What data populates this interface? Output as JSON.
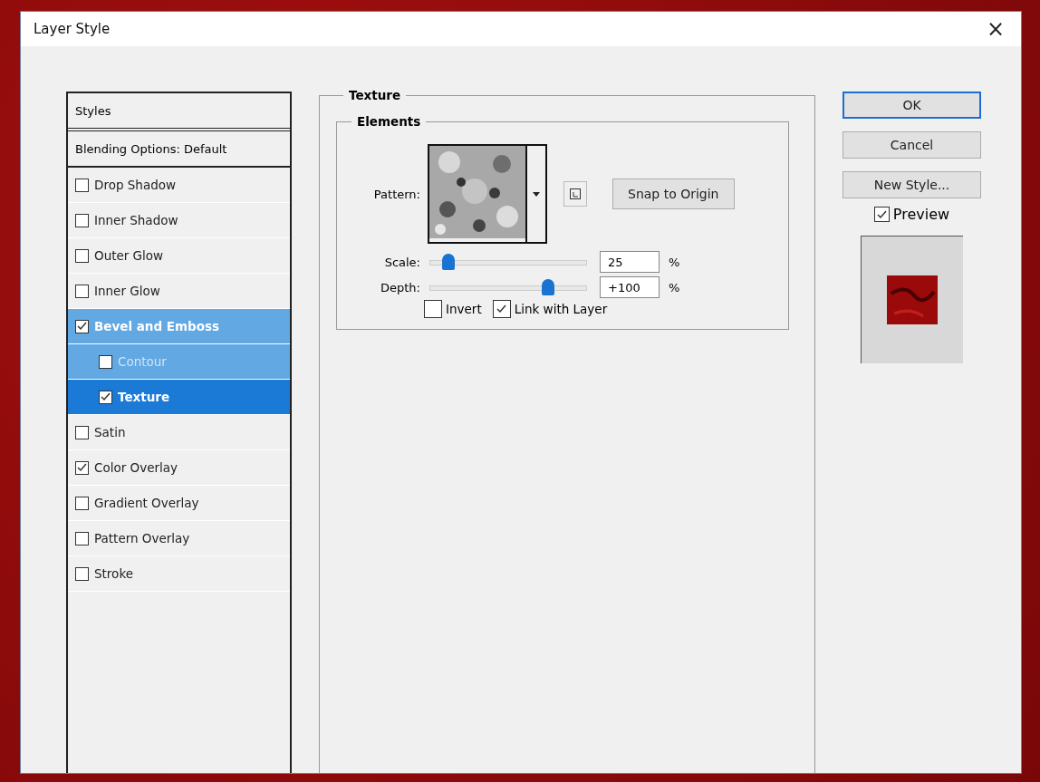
{
  "window": {
    "title": "Layer Style",
    "close": "×"
  },
  "styles_list": {
    "header": "Styles",
    "blending": "Blending Options: Default",
    "items": [
      {
        "label": "Drop Shadow",
        "checked": false,
        "selected": false,
        "grouped": false
      },
      {
        "label": "Inner Shadow",
        "checked": false,
        "selected": false,
        "grouped": false
      },
      {
        "label": "Outer Glow",
        "checked": false,
        "selected": false,
        "grouped": false
      },
      {
        "label": "Inner Glow",
        "checked": false,
        "selected": false,
        "grouped": false
      },
      {
        "label": "Bevel and Emboss",
        "checked": true,
        "selected": false,
        "grouped": true,
        "children": [
          {
            "label": "Contour",
            "checked": false,
            "selected": false,
            "grouped": true
          },
          {
            "label": "Texture",
            "checked": true,
            "selected": true,
            "grouped": true
          }
        ]
      },
      {
        "label": "Satin",
        "checked": false,
        "selected": false,
        "grouped": false
      },
      {
        "label": "Color Overlay",
        "checked": true,
        "selected": false,
        "grouped": false
      },
      {
        "label": "Gradient Overlay",
        "checked": false,
        "selected": false,
        "grouped": false
      },
      {
        "label": "Pattern Overlay",
        "checked": false,
        "selected": false,
        "grouped": false
      },
      {
        "label": "Stroke",
        "checked": false,
        "selected": false,
        "grouped": false
      }
    ]
  },
  "texture": {
    "title": "Texture",
    "elements": {
      "title": "Elements",
      "pattern_label": "Pattern:",
      "snap_button": "Snap to Origin",
      "sliders": [
        {
          "label": "Scale:",
          "level": 0.12,
          "value": "25",
          "unit": "%"
        },
        {
          "label": "Depth:",
          "level": 0.75,
          "value": "+100",
          "unit": "%"
        }
      ],
      "options": [
        {
          "label": "Invert",
          "checked": false
        },
        {
          "label": "Link with Layer",
          "checked": true
        }
      ]
    }
  },
  "buttons": [
    {
      "label": "OK",
      "default": true
    },
    {
      "label": "Cancel",
      "default": false
    },
    {
      "label": "New Style...",
      "default": false
    }
  ],
  "preview": {
    "label": "Preview",
    "checked": true
  }
}
